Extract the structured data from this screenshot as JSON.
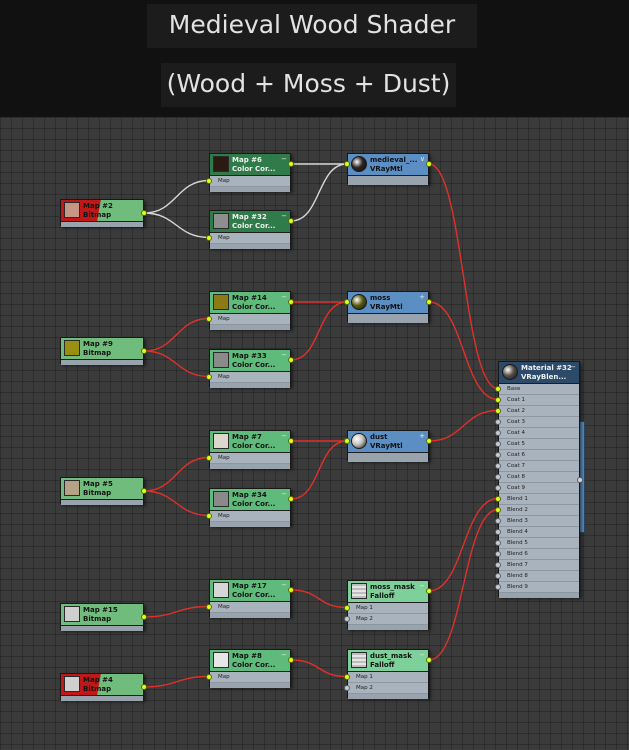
{
  "header": {
    "title": "Medieval Wood Shader",
    "subtitle": "(Wood + Moss + Dust)"
  },
  "colors": {
    "header_bg": "#111111",
    "canvas_bg": "#3b3b3b",
    "bitmap_head": "#6fbc7c",
    "bitmap_head_selected": "#c01818",
    "cc_head_wood": "#2f7b49",
    "cc_head": "#5fbb7b",
    "vray_head": "#5b8ec2",
    "blend_head": "#2c4a6a",
    "falloff_head": "#7ed09a",
    "wire_white": "#d8d8d8",
    "wire_red": "#e0302a",
    "port_active": "#dcff1e"
  },
  "nodes": {
    "bitmap_map2": {
      "title": "Map #2",
      "subtitle": "Bitmap",
      "swatch": "#c79785"
    },
    "bitmap_map9": {
      "title": "Map #9",
      "subtitle": "Bitmap",
      "swatch": "#9a8f10"
    },
    "bitmap_map5": {
      "title": "Map #5",
      "subtitle": "Bitmap",
      "swatch": "#b6a285"
    },
    "bitmap_map15": {
      "title": "Map #15",
      "subtitle": "Bitmap",
      "swatch": "#cfcfcf"
    },
    "bitmap_map4": {
      "title": "Map #4",
      "subtitle": "Bitmap",
      "swatch": "#cfcfcf"
    },
    "cc_map6": {
      "title": "Map #6",
      "subtitle": "Color Cor...",
      "slot": "Map",
      "swatch": "#2a1a12"
    },
    "cc_map32": {
      "title": "Map #32",
      "subtitle": "Color Cor...",
      "slot": "Map",
      "swatch": "#8e8e8e"
    },
    "cc_map14": {
      "title": "Map #14",
      "subtitle": "Color Cor...",
      "slot": "Map",
      "swatch": "#8c7a15"
    },
    "cc_map33": {
      "title": "Map #33",
      "subtitle": "Color Cor...",
      "slot": "Map",
      "swatch": "#8a8a8a"
    },
    "cc_map7": {
      "title": "Map #7",
      "subtitle": "Color Cor...",
      "slot": "Map",
      "swatch": "#dcd6cc"
    },
    "cc_map34": {
      "title": "Map #34",
      "subtitle": "Color Cor...",
      "slot": "Map",
      "swatch": "#8a8a8a"
    },
    "cc_map17": {
      "title": "Map #17",
      "subtitle": "Color Cor...",
      "slot": "Map",
      "swatch": "#d6d6d6"
    },
    "cc_map8": {
      "title": "Map #8",
      "subtitle": "Color Cor...",
      "slot": "Map",
      "swatch": "#e6e6e6"
    },
    "vray_medieval": {
      "title": "medieval_...",
      "subtitle": "VRayMtl",
      "swatch": "#2c2420"
    },
    "vray_moss": {
      "title": "moss",
      "subtitle": "VRayMtl",
      "swatch": "#595a0e"
    },
    "vray_dust": {
      "title": "dust",
      "subtitle": "VRayMtl",
      "swatch": "#c6c2bc"
    },
    "falloff_moss": {
      "title": "moss_mask",
      "subtitle": "Falloff",
      "slot1": "Map 1",
      "slot2": "Map 2",
      "swatch": "#cfcfcf"
    },
    "falloff_dust": {
      "title": "dust_mask",
      "subtitle": "Falloff",
      "slot1": "Map 1",
      "slot2": "Map 2",
      "swatch": "#dadada"
    },
    "blend_material": {
      "title": "Material #32",
      "subtitle": "VRayBlen...",
      "swatch": "#5a5048",
      "slots": [
        "Base",
        "Coat 1",
        "Coat 2",
        "Coat 3",
        "Coat 4",
        "Coat 5",
        "Coat 6",
        "Coat 7",
        "Coat 8",
        "Coat 9",
        "Blend 1",
        "Blend 2",
        "Blend 3",
        "Blend 4",
        "Blend 5",
        "Blend 6",
        "Blend 7",
        "Blend 8",
        "Blend 9"
      ],
      "active_slots": [
        "Base",
        "Coat 1",
        "Coat 2",
        "Blend 1",
        "Blend 2"
      ]
    }
  },
  "connections": [
    {
      "from": "bitmap_map2",
      "to": "cc_map6",
      "color": "white"
    },
    {
      "from": "bitmap_map2",
      "to": "cc_map32",
      "color": "white"
    },
    {
      "from": "cc_map6",
      "to": "vray_medieval",
      "color": "white"
    },
    {
      "from": "cc_map32",
      "to": "vray_medieval",
      "color": "white"
    },
    {
      "from": "bitmap_map9",
      "to": "cc_map14",
      "color": "red"
    },
    {
      "from": "bitmap_map9",
      "to": "cc_map33",
      "color": "red"
    },
    {
      "from": "cc_map14",
      "to": "vray_moss",
      "color": "red"
    },
    {
      "from": "cc_map33",
      "to": "vray_moss",
      "color": "red"
    },
    {
      "from": "bitmap_map5",
      "to": "cc_map7",
      "color": "red"
    },
    {
      "from": "bitmap_map5",
      "to": "cc_map34",
      "color": "red"
    },
    {
      "from": "cc_map7",
      "to": "vray_dust",
      "color": "red"
    },
    {
      "from": "cc_map34",
      "to": "vray_dust",
      "color": "red"
    },
    {
      "from": "bitmap_map15",
      "to": "cc_map17",
      "color": "red"
    },
    {
      "from": "bitmap_map4",
      "to": "cc_map8",
      "color": "red"
    },
    {
      "from": "cc_map17",
      "to": "falloff_moss",
      "color": "red"
    },
    {
      "from": "cc_map8",
      "to": "falloff_dust",
      "color": "red"
    },
    {
      "from": "vray_medieval",
      "to": "blend_material",
      "slot": "Base",
      "color": "red"
    },
    {
      "from": "vray_moss",
      "to": "blend_material",
      "slot": "Coat 1",
      "color": "red"
    },
    {
      "from": "vray_dust",
      "to": "blend_material",
      "slot": "Coat 2",
      "color": "red"
    },
    {
      "from": "falloff_moss",
      "to": "blend_material",
      "slot": "Blend 1",
      "color": "red"
    },
    {
      "from": "falloff_dust",
      "to": "blend_material",
      "slot": "Blend 2",
      "color": "red"
    }
  ]
}
